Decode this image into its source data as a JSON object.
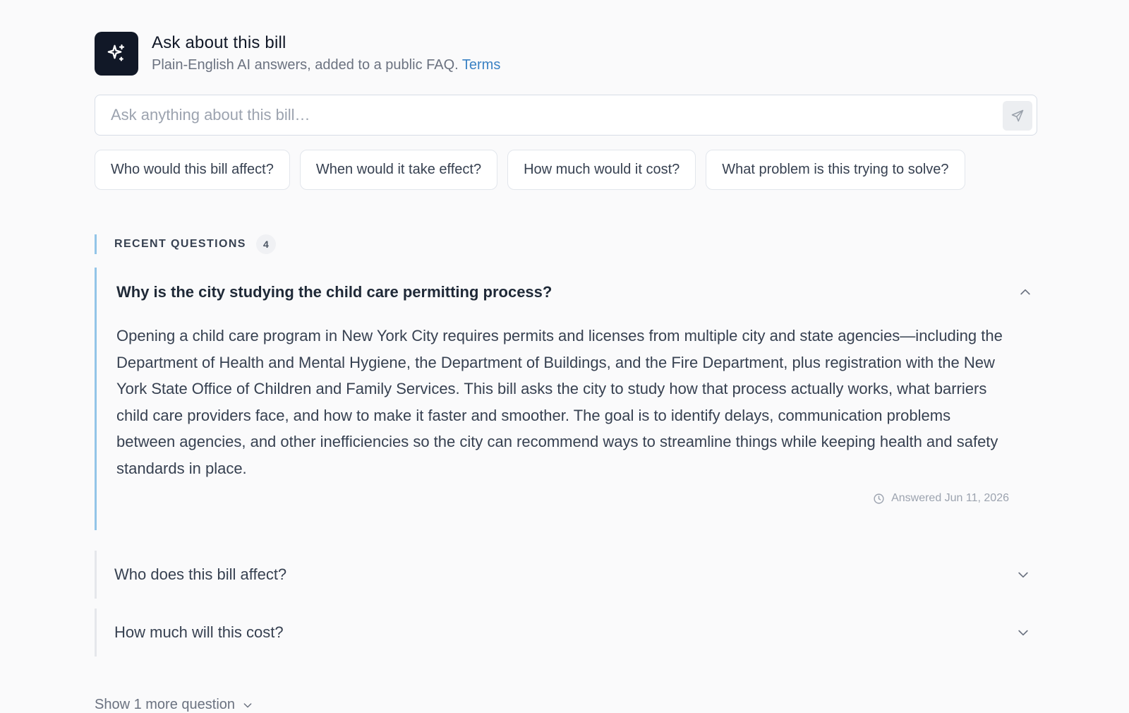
{
  "header": {
    "title": "Ask about this bill",
    "subtitle": "Plain-English AI answers, added to a public FAQ.",
    "terms_link": "Terms",
    "logo_icon": "sparkle-icon"
  },
  "search": {
    "placeholder": "Ask anything about this bill…",
    "value": "",
    "send_icon": "send-icon"
  },
  "suggestions": [
    "Who would this bill affect?",
    "When would it take effect?",
    "How much would it cost?",
    "What problem is this trying to solve?"
  ],
  "recent": {
    "label": "RECENT QUESTIONS",
    "count": "4",
    "items": [
      {
        "question": "Why is the city studying the child care permitting process?",
        "expanded": true,
        "answer": "Opening a child care program in New York City requires permits and licenses from multiple city and state agencies—including the Department of Health and Mental Hygiene, the Department of Buildings, and the Fire Department, plus registration with the New York State Office of Children and Family Services. This bill asks the city to study how that process actually works, what barriers child care providers face, and how to make it faster and smoother. The goal is to identify delays, communication problems between agencies, and other inefficiencies so the city can recommend ways to streamline things while keeping health and safety standards in place.",
        "answered": "Answered Jun 11, 2026"
      },
      {
        "question": "Who does this bill affect?",
        "expanded": false
      },
      {
        "question": "How much will this cost?",
        "expanded": false
      }
    ],
    "show_more": "Show 1 more question"
  },
  "colors": {
    "accent": "#3b82c4",
    "active_bar": "#93c5e8",
    "logo_bg": "#111827"
  }
}
